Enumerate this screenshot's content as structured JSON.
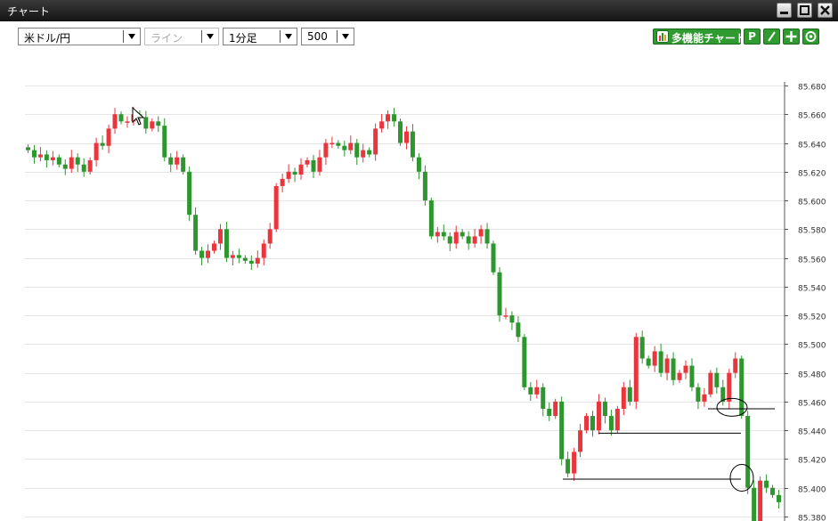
{
  "window": {
    "title": "チャート"
  },
  "toolbar": {
    "pair": "米ドル/円",
    "chart_type": "ライン",
    "timeframe": "1分足",
    "count": "500",
    "multi_chart_label": "多機能チャート",
    "btn_p": "P"
  },
  "colors": {
    "up": "#e8363c",
    "down": "#2e962e",
    "grid": "#e6e6e6",
    "accent_green": "#2f9a2f"
  },
  "chart_data": {
    "type": "candlestick",
    "y_ticks": [
      "85.680",
      "85.660",
      "85.640",
      "85.620",
      "85.600",
      "85.580",
      "85.560",
      "85.540",
      "85.520",
      "85.500",
      "85.480",
      "85.460",
      "85.440",
      "85.420",
      "85.400",
      "85.380"
    ],
    "ylim": [
      85.38,
      85.68
    ],
    "close_approx": [
      85.635,
      85.63,
      85.632,
      85.628,
      85.63,
      85.625,
      85.622,
      85.63,
      85.625,
      85.62,
      85.628,
      85.64,
      85.638,
      85.65,
      85.66,
      85.655,
      85.655,
      85.66,
      85.658,
      85.65,
      85.655,
      85.652,
      85.63,
      85.625,
      85.63,
      85.62,
      85.59,
      85.565,
      85.56,
      85.565,
      85.57,
      85.58,
      85.56,
      85.562,
      85.56,
      85.558,
      85.556,
      85.56,
      85.57,
      85.58,
      85.61,
      85.615,
      85.62,
      85.618,
      85.625,
      85.628,
      85.62,
      85.63,
      85.64,
      85.64,
      85.638,
      85.635,
      85.64,
      85.63,
      85.635,
      85.632,
      85.65,
      85.655,
      85.66,
      85.655,
      85.64,
      85.648,
      85.63,
      85.62,
      85.6,
      85.575,
      85.578,
      85.575,
      85.57,
      85.578,
      85.575,
      85.57,
      85.575,
      85.58,
      85.57,
      85.55,
      85.52,
      85.52,
      85.515,
      85.505,
      85.47,
      85.465,
      85.47,
      85.455,
      85.45,
      85.46,
      85.42,
      85.41,
      85.425,
      85.44,
      85.45,
      85.44,
      85.46,
      85.45,
      85.44,
      85.455,
      85.47,
      85.46,
      85.505,
      85.49,
      85.485,
      85.495,
      85.48,
      85.49,
      85.475,
      85.48,
      85.485,
      85.47,
      85.46,
      85.465,
      85.48,
      85.47,
      85.46,
      85.48,
      85.49,
      85.45,
      85.4,
      85.375,
      85.405,
      85.4,
      85.395,
      85.39
    ]
  }
}
